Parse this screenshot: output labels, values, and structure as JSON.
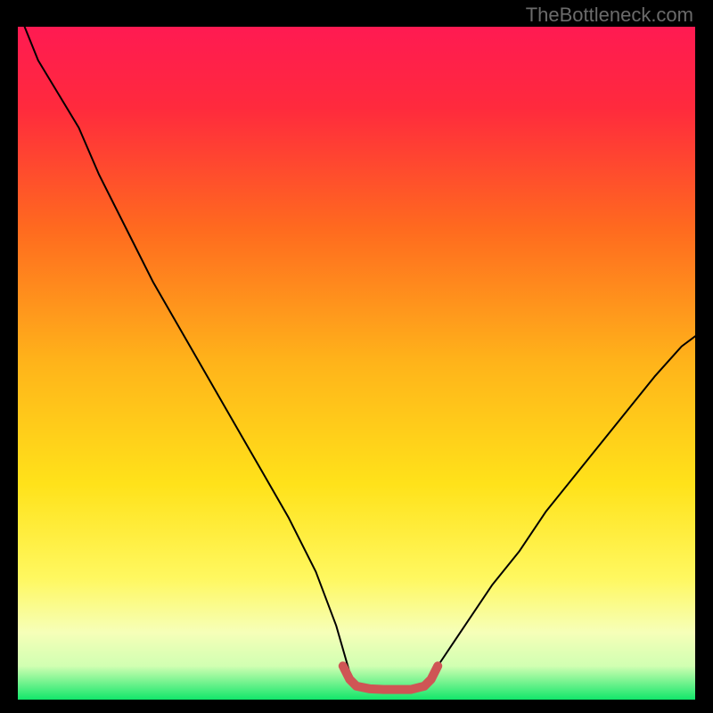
{
  "watermark": "TheBottleneck.com",
  "chart_data": {
    "type": "line",
    "title": "",
    "xlabel": "",
    "ylabel": "",
    "xlim": [
      0,
      100
    ],
    "ylim": [
      0,
      100
    ],
    "grid": false,
    "legend": false,
    "gradient_stops": [
      {
        "offset": 0.0,
        "color": "#ff1a52"
      },
      {
        "offset": 0.12,
        "color": "#ff2a3d"
      },
      {
        "offset": 0.3,
        "color": "#ff6a1f"
      },
      {
        "offset": 0.5,
        "color": "#ffb41a"
      },
      {
        "offset": 0.68,
        "color": "#ffe21a"
      },
      {
        "offset": 0.82,
        "color": "#fff860"
      },
      {
        "offset": 0.9,
        "color": "#f6ffb8"
      },
      {
        "offset": 0.95,
        "color": "#d1ffb2"
      },
      {
        "offset": 1.0,
        "color": "#12e66a"
      }
    ],
    "series": [
      {
        "name": "black-curve",
        "color": "#000000",
        "width": 2,
        "x": [
          1.0,
          3.0,
          6.0,
          9.0,
          12.0,
          16.0,
          20.0,
          24.0,
          28.0,
          32.0,
          36.0,
          40.0,
          44.0,
          47.0,
          49.0,
          50.0,
          52.0,
          54.0,
          56.0,
          58.0,
          60.0,
          62.0,
          66.0,
          70.0,
          74.0,
          78.0,
          82.0,
          86.0,
          90.0,
          94.0,
          98.0,
          100.0
        ],
        "y": [
          100.0,
          95.0,
          90.0,
          85.0,
          78.0,
          70.0,
          62.0,
          55.0,
          48.0,
          41.0,
          34.0,
          27.0,
          19.0,
          11.0,
          4.0,
          2.0,
          1.5,
          1.5,
          1.5,
          1.5,
          2.0,
          5.0,
          11.0,
          17.0,
          22.0,
          28.0,
          33.0,
          38.0,
          43.0,
          48.0,
          52.5,
          54.0
        ]
      },
      {
        "name": "red-floor-segment",
        "color": "#cf5555",
        "width": 10,
        "x": [
          48.0,
          49.0,
          50.0,
          52.0,
          54.0,
          56.0,
          58.0,
          60.0,
          61.0,
          62.0
        ],
        "y": [
          5.0,
          3.0,
          2.0,
          1.6,
          1.5,
          1.5,
          1.5,
          2.0,
          3.0,
          5.0
        ]
      }
    ]
  }
}
